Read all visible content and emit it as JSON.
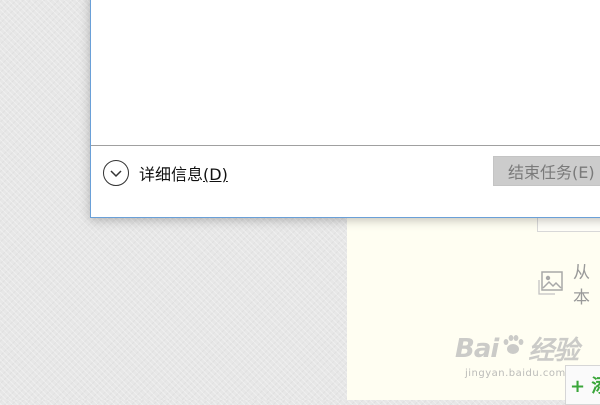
{
  "dialog": {
    "details_label": "详细信息",
    "details_accel": "(D)",
    "end_task_label": "结束任务(E)"
  },
  "background_page": {
    "upload_text": "从本",
    "add_text": "+ 添"
  },
  "watermark": {
    "main_left": "Bai",
    "main_right": "经验",
    "sub": "jingyan.baidu.com"
  }
}
